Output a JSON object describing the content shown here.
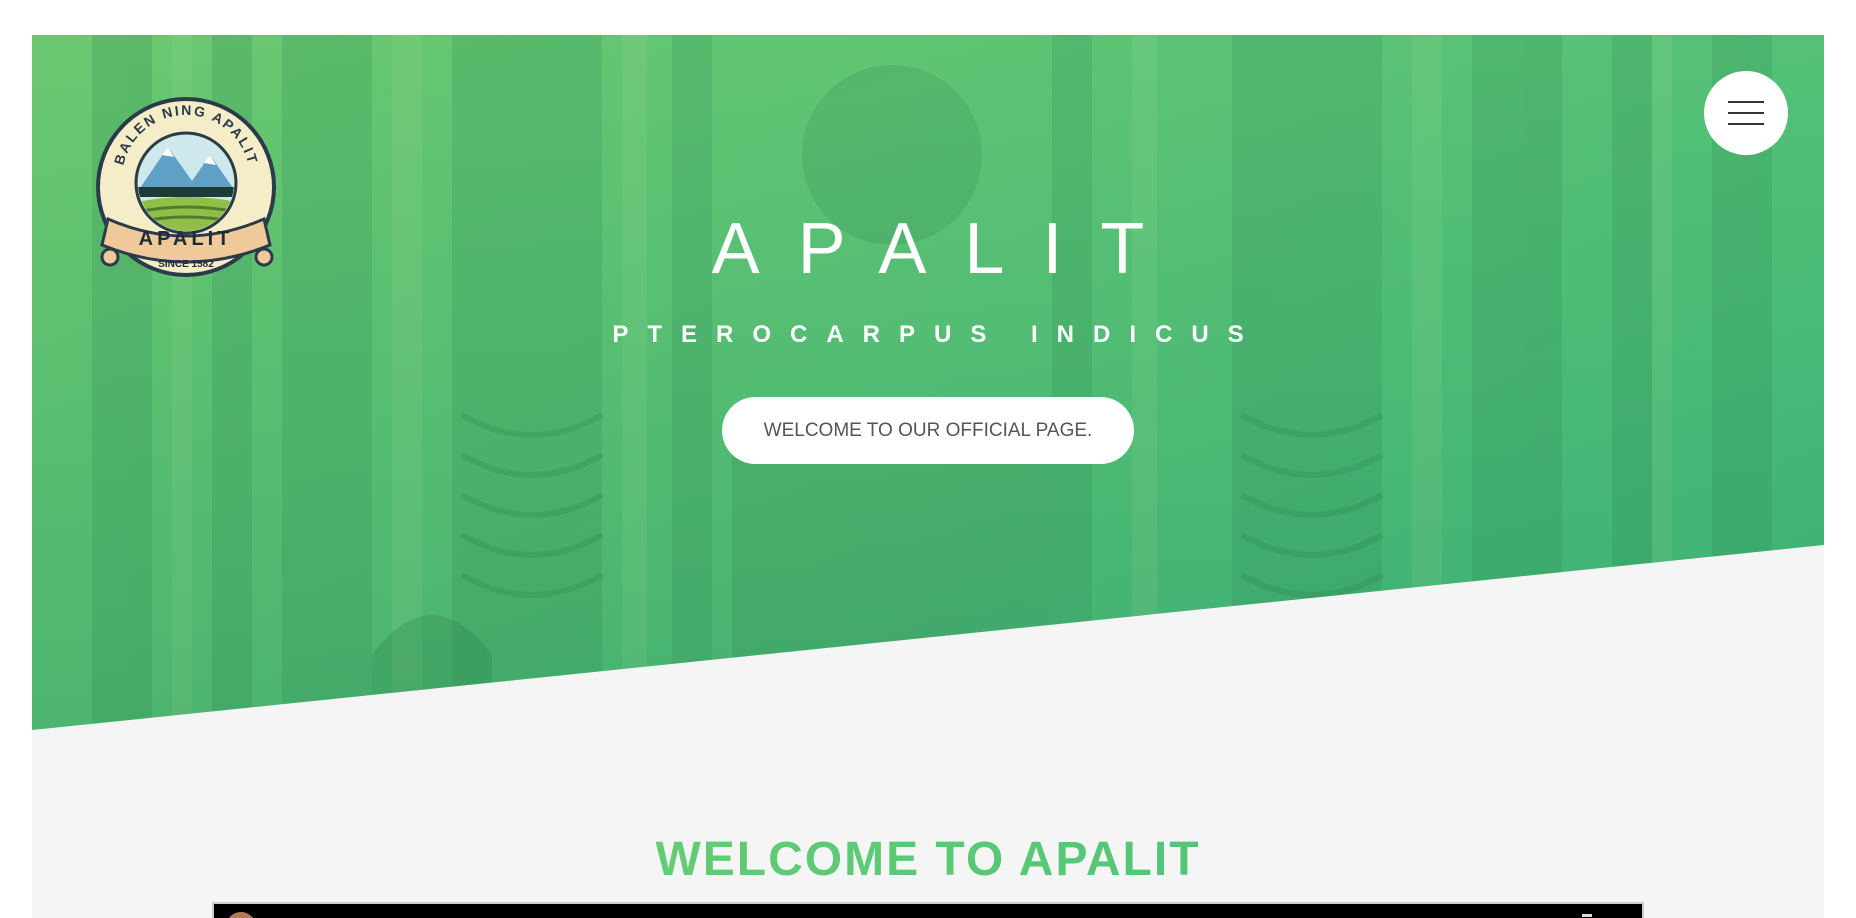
{
  "hero": {
    "title": "APALIT",
    "subtitle": "PTEROCARPUS INDICUS",
    "cta_label": "WELCOME TO OUR OFFICIAL PAGE.",
    "background": "church-altar-photo",
    "overlay_colors": [
      "#6fd077",
      "#3ec186"
    ]
  },
  "logo": {
    "arc_text": "BALEN NING APALIT",
    "banner_text": "APALIT",
    "since_text": "SINCE 1582"
  },
  "nav": {
    "menu_icon": "hamburger-menu-icon"
  },
  "section": {
    "heading": "WELCOME TO APALIT",
    "heading_colors": [
      "#78d36f",
      "#33b57e"
    ]
  },
  "video": {
    "icon": "video-embed"
  }
}
